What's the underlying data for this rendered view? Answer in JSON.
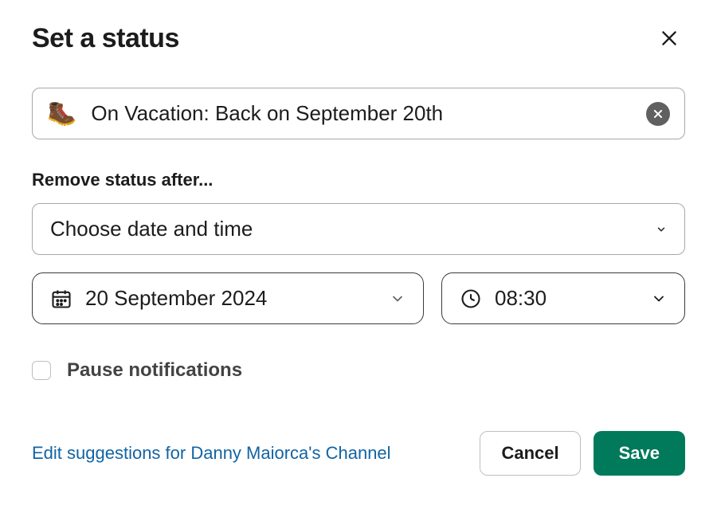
{
  "title": "Set a status",
  "status": {
    "emoji": "🥾",
    "text": "On Vacation: Back on September 20th"
  },
  "removeAfter": {
    "label": "Remove status after...",
    "selectText": "Choose date and time",
    "date": "20 September 2024",
    "time": "08:30"
  },
  "pause": {
    "label": "Pause notifications",
    "checked": false
  },
  "footer": {
    "editLink": "Edit suggestions for Danny Maiorca's Channel",
    "cancel": "Cancel",
    "save": "Save"
  }
}
